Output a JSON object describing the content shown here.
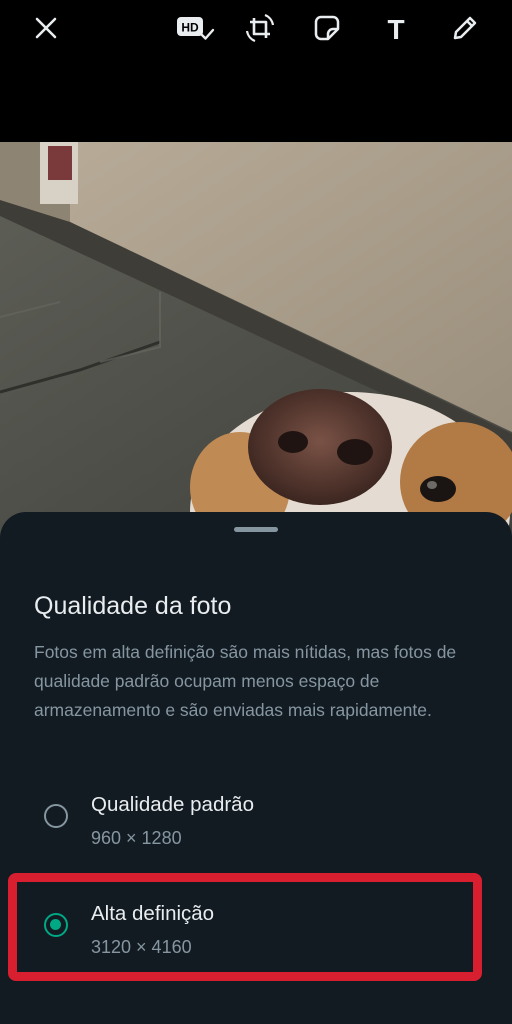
{
  "toolbar": {
    "close_icon": "close-icon",
    "hd_icon": "hd-quality-icon",
    "hd_badge_text": "HD",
    "crop_icon": "crop-rotate-icon",
    "sticker_icon": "sticker-icon",
    "text_icon": "text-icon",
    "text_glyph": "T",
    "draw_icon": "pencil-icon"
  },
  "photo": {
    "description_icon": "photo-preview"
  },
  "sheet": {
    "title": "Qualidade da foto",
    "description": "Fotos em alta definição são mais nítidas, mas fotos de qualidade padrão ocupam menos espaço de armazenamento e são enviadas mais rapidamente.",
    "options": [
      {
        "label": "Qualidade padrão",
        "resolution": "960 × 1280",
        "selected": false
      },
      {
        "label": "Alta definição",
        "resolution": "3120 × 4160",
        "selected": true
      }
    ]
  },
  "colors": {
    "sheet_background": "#121b22",
    "primary_text": "#e9edef",
    "secondary_text": "#8696a0",
    "accent": "#00a884",
    "highlight": "#d81f2f"
  }
}
